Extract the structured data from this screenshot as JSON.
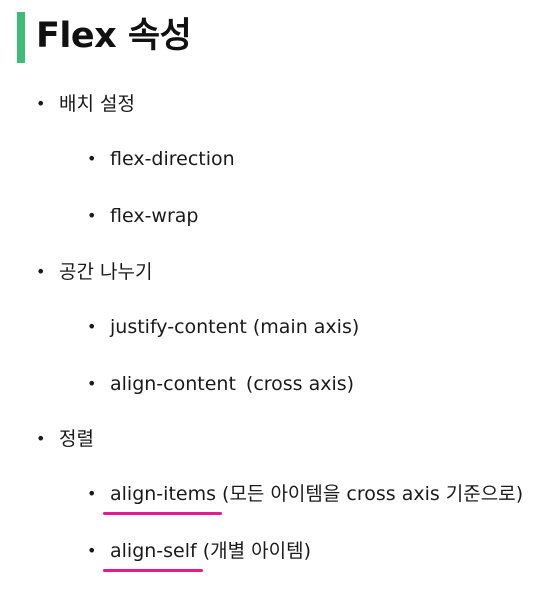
{
  "title": "Flex 속성",
  "colors": {
    "accent_bar": "#3dbb7a",
    "highlight_underline": "#e8198c"
  },
  "bullet_glyph": "•",
  "sections": [
    {
      "label": "배치 설정",
      "items": [
        {
          "text": "flex-direction"
        },
        {
          "text": "flex-wrap"
        }
      ]
    },
    {
      "label": "공간 나누기",
      "items": [
        {
          "text": "justify-content (main axis)"
        },
        {
          "text": "align-content",
          "note": "(cross axis)"
        }
      ]
    },
    {
      "label": "정렬",
      "items": [
        {
          "text": "align-items",
          "note": "(모든 아이템을 cross axis 기준으로)",
          "highlighted": true
        },
        {
          "text": "align-self",
          "note": "(개별 아이템)",
          "highlighted": true
        }
      ]
    }
  ]
}
